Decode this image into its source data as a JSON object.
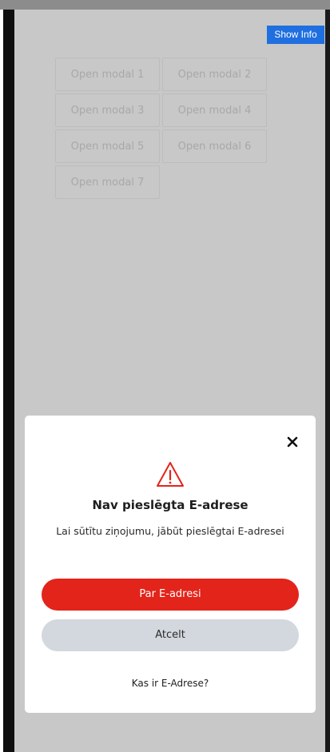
{
  "header": {
    "show_info_label": "Show Info"
  },
  "modal_buttons": [
    "Open modal 1",
    "Open modal 2",
    "Open modal 3",
    "Open modal 4",
    "Open modal 5",
    "Open modal 6",
    "Open modal 7"
  ],
  "dialog": {
    "icon": "warning-triangle-icon",
    "close_icon": "close-icon",
    "title": "Nav pieslēgta E-adrese",
    "message": "Lai sūtītu ziņojumu, jābūt pieslēgtai E-adresei",
    "primary_label": "Par E-adresi",
    "secondary_label": "Atcelt",
    "link_label": "Kas ir E-Adrese?"
  },
  "colors": {
    "primary": "#e3241b",
    "secondary": "#d3d8de",
    "show_info": "#1f6fe0",
    "overlay": "#c8c8c8"
  }
}
